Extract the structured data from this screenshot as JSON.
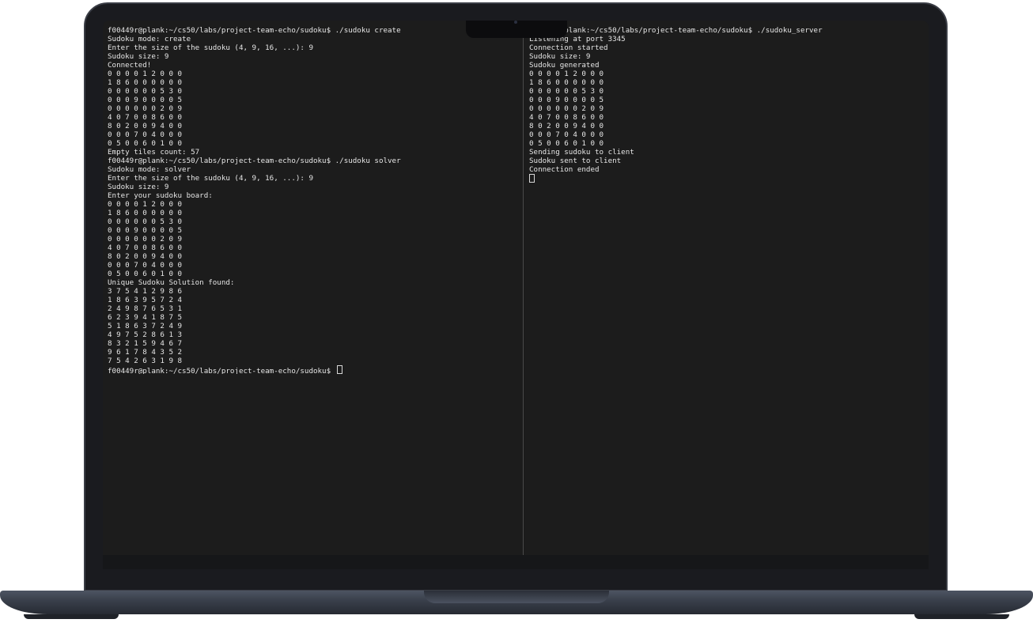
{
  "left_terminal": {
    "lines": [
      "f00449r@plank:~/cs50/labs/project-team-echo/sudoku$ ./sudoku create",
      "Sudoku mode: create",
      "Enter the size of the sudoku (4, 9, 16, ...): 9",
      "Sudoku size: 9",
      "Connected!",
      "0 0 0 0 1 2 0 0 0",
      "1 8 6 0 0 0 0 0 0",
      "0 0 0 0 0 0 5 3 0",
      "0 0 0 9 0 0 0 0 5",
      "0 0 0 0 0 0 2 0 9",
      "4 0 7 0 0 8 6 0 0",
      "8 0 2 0 0 9 4 0 0",
      "0 0 0 7 0 4 0 0 0",
      "0 5 0 0 6 0 1 0 0",
      "Empty tiles count: 57",
      "f00449r@plank:~/cs50/labs/project-team-echo/sudoku$ ./sudoku solver",
      "Sudoku mode: solver",
      "Enter the size of the sudoku (4, 9, 16, ...): 9",
      "Sudoku size: 9",
      "Enter your sudoku board:",
      "0 0 0 0 1 2 0 0 0",
      "1 8 6 0 0 0 0 0 0",
      "0 0 0 0 0 0 5 3 0",
      "0 0 0 9 0 0 0 0 5",
      "0 0 0 0 0 0 2 0 9",
      "4 0 7 0 0 8 6 0 0",
      "8 0 2 0 0 9 4 0 0",
      "0 0 0 7 0 4 0 0 0",
      "0 5 0 0 6 0 1 0 0",
      "Unique Sudoku Solution found:",
      "3 7 5 4 1 2 9 8 6",
      "1 8 6 3 9 5 7 2 4",
      "2 4 9 8 7 6 5 3 1",
      "6 2 3 9 4 1 8 7 5",
      "5 1 8 6 3 7 2 4 9",
      "4 9 7 5 2 8 6 1 3",
      "8 3 2 1 5 9 4 6 7",
      "9 6 1 7 8 4 3 5 2",
      "7 5 4 2 6 3 1 9 8"
    ],
    "prompt": "f00449r@plank:~/cs50/labs/project-team-echo/sudoku$ "
  },
  "right_terminal": {
    "lines": [
      "f00449r@plank:~/cs50/labs/project-team-echo/sudoku$ ./sudoku_server",
      "Listening at port 3345",
      "Connection started",
      "Sudoku size: 9",
      "Sudoku generated",
      "0 0 0 0 1 2 0 0 0",
      "1 8 6 0 0 0 0 0 0",
      "0 0 0 0 0 0 5 3 0",
      "0 0 0 9 0 0 0 0 5",
      "0 0 0 0 0 0 2 0 9",
      "4 0 7 0 0 8 6 0 0",
      "8 0 2 0 0 9 4 0 0",
      "0 0 0 7 0 4 0 0 0",
      "0 5 0 0 6 0 1 0 0",
      "Sending sudoku to client",
      "Sudoku sent to client",
      "Connection ended"
    ]
  }
}
